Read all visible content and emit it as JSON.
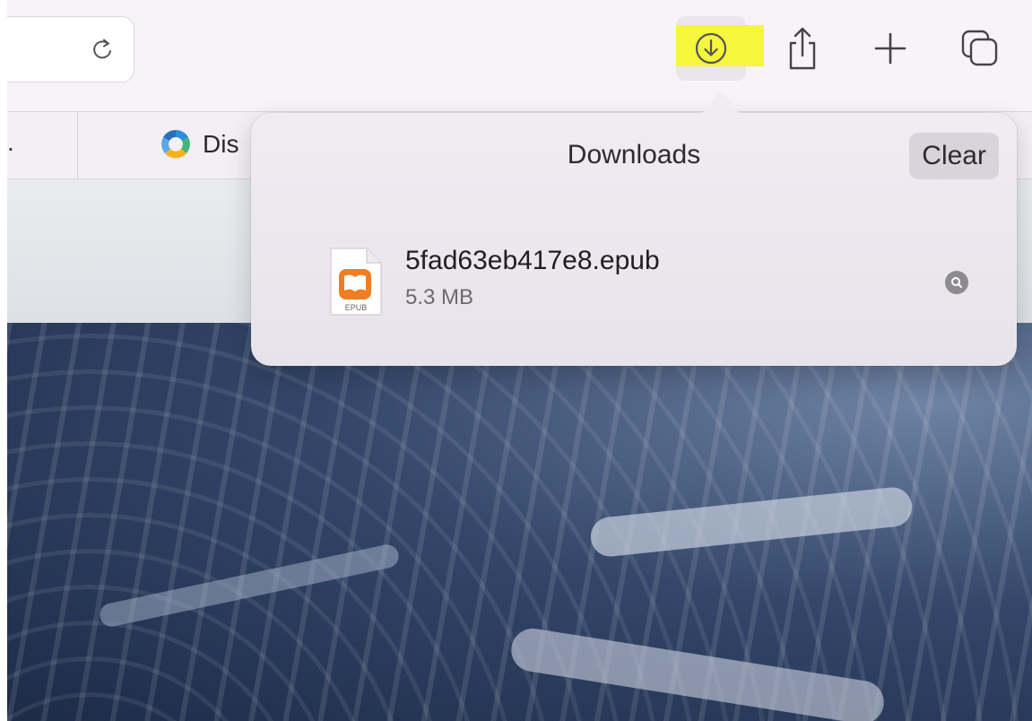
{
  "toolbar": {
    "icons": {
      "reload": "reload-icon",
      "downloads": "download-circle-icon",
      "share": "share-icon",
      "new_tab": "plus-icon",
      "tab_overview": "tab-overview-icon"
    },
    "highlight_color": "#f4f73c"
  },
  "favorites": {
    "overflow": ".",
    "items": [
      {
        "label": "Dis",
        "icon": "favicon-icon"
      }
    ]
  },
  "downloads": {
    "title": "Downloads",
    "clear_label": "Clear",
    "items": [
      {
        "name": "5fad63eb417e8.epub",
        "size": "5.3 MB",
        "icon": "epub-file-icon",
        "icon_label": "EPUB",
        "icon_color": "#f27c1f"
      }
    ]
  }
}
